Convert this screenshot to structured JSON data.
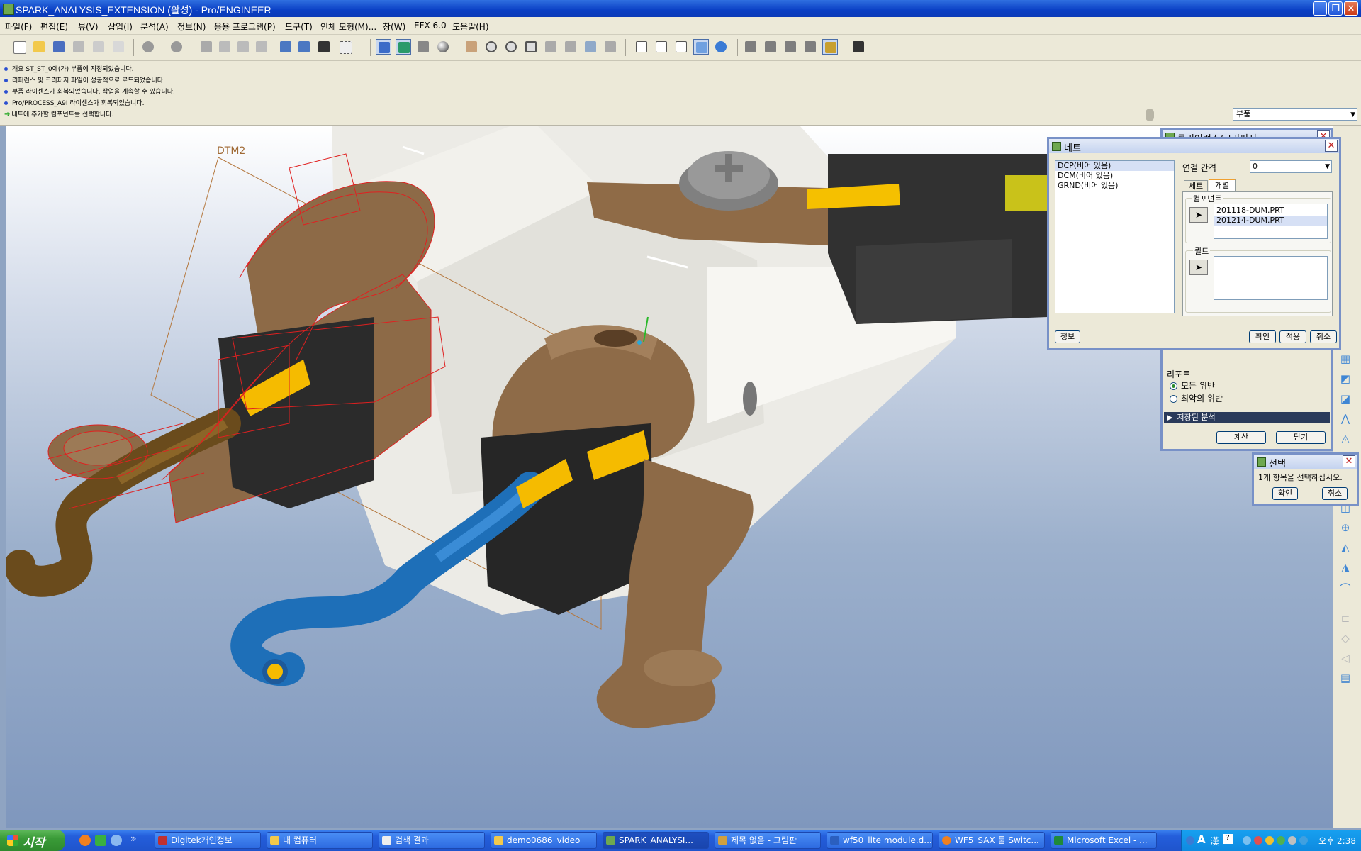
{
  "window": {
    "title": "SPARK_ANALYSIS_EXTENSION (활성) - Pro/ENGINEER"
  },
  "menu": [
    "파일(F)",
    "편집(E)",
    "뷰(V)",
    "삽입(I)",
    "분석(A)",
    "정보(N)",
    "응용 프로그램(P)",
    "도구(T)",
    "인체 모형(M)...",
    "창(W)",
    "EFX 6.0",
    "도움말(H)"
  ],
  "messages": [
    "개요 ST_ST_0에(가) 부품에 지정되었습니다.",
    "리퍼런스 및 크리퍼지 파일이 성공적으로 로드되었습니다.",
    "부품 라이센스가 회복되었습니다. 작업을 계속할 수 있습니다.",
    "Pro/PROCESS_A9I 라이센스가 회복되었습니다.",
    "네트에 추가할 컴포넌트를 선택합니다."
  ],
  "filter": {
    "value": "부품"
  },
  "viewport": {
    "datum_label": "DTM2"
  },
  "net_dialog": {
    "title": "네트",
    "nets": [
      "DCP(비어 있음)",
      "DCM(비어 있음)",
      "GRND(비어 있음)"
    ],
    "selected_net": 0,
    "gap_label": "연결 간격",
    "gap_value": "0",
    "tabs": [
      "세트",
      "개별"
    ],
    "active_tab": 1,
    "components_label": "컴포넌트",
    "components": [
      "201118-DUM.PRT",
      "201214-DUM.PRT"
    ],
    "selected_component": 1,
    "points_label": "퀼트",
    "info_button": "정보",
    "ok_button": "확인",
    "apply_button": "적용",
    "cancel_button": "취소"
  },
  "clearance_dialog": {
    "title": "클리어런스/크리피지",
    "report_label": "리포트",
    "report_options": [
      "모든 위반",
      "최악의 위반"
    ],
    "report_selected": 0,
    "saved_analysis": "저장된 분석",
    "compute_button": "계산",
    "close_button": "닫기"
  },
  "select_dialog": {
    "title": "선택",
    "prompt": "1개 항목을 선택하십시오.",
    "ok_button": "확인",
    "cancel_button": "취소"
  },
  "taskbar": {
    "start": "시작",
    "tasks": [
      "Digitek개인정보",
      "내 컴퓨터",
      "검색 결과",
      "demo0686_video",
      "SPARK_ANALYSI...",
      "제목 없음 - 그림판",
      "wf50_lite module.d...",
      "WF5_SAX 툴 Switc...",
      "Microsoft Excel - ..."
    ],
    "active_task": 4,
    "clock": "오후 2:38"
  }
}
